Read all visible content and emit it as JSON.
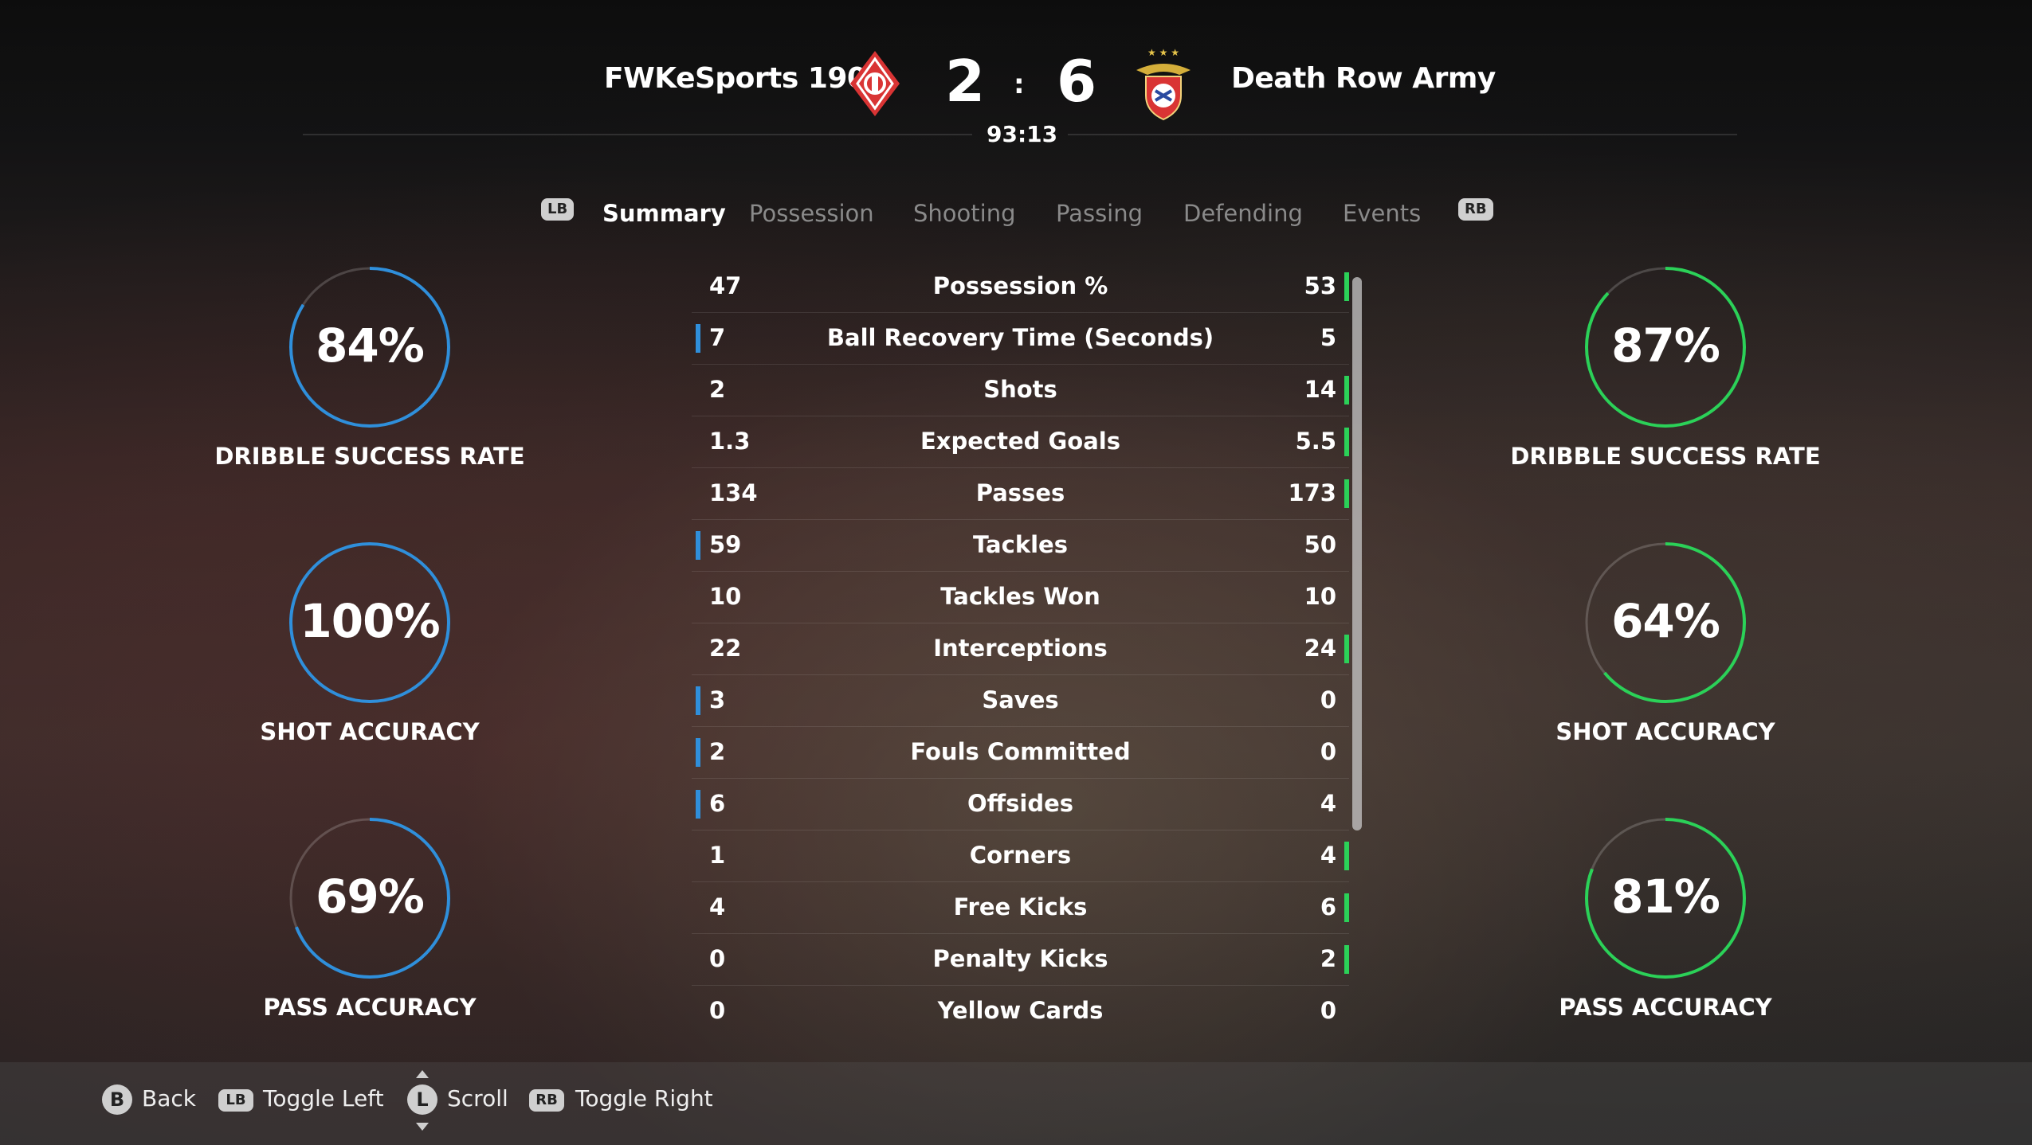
{
  "match": {
    "home_team": "FWKeSports 1907",
    "away_team": "Death Row Army",
    "home_score": "2",
    "away_score": "6",
    "separator": ":",
    "clock": "93:13"
  },
  "tabs": {
    "left_button": "LB",
    "right_button": "RB",
    "items": [
      "Summary",
      "Possession",
      "Shooting",
      "Passing",
      "Defending",
      "Events"
    ],
    "active": "Summary"
  },
  "colors": {
    "home": "#2f8fdb",
    "away": "#2bd158"
  },
  "home_rings": [
    {
      "value": "84%",
      "label": "DRIBBLE SUCCESS RATE",
      "fraction": 0.84
    },
    {
      "value": "100%",
      "label": "SHOT ACCURACY",
      "fraction": 1.0
    },
    {
      "value": "69%",
      "label": "PASS ACCURACY",
      "fraction": 0.69
    }
  ],
  "away_rings": [
    {
      "value": "87%",
      "label": "DRIBBLE SUCCESS RATE",
      "fraction": 0.87
    },
    {
      "value": "64%",
      "label": "SHOT ACCURACY",
      "fraction": 0.64
    },
    {
      "value": "81%",
      "label": "PASS ACCURACY",
      "fraction": 0.81
    }
  ],
  "stats": [
    {
      "name": "Possession %",
      "home": "47",
      "away": "53",
      "leader": "away"
    },
    {
      "name": "Ball Recovery Time (Seconds)",
      "home": "7",
      "away": "5",
      "leader": "home"
    },
    {
      "name": "Shots",
      "home": "2",
      "away": "14",
      "leader": "away"
    },
    {
      "name": "Expected Goals",
      "home": "1.3",
      "away": "5.5",
      "leader": "away"
    },
    {
      "name": "Passes",
      "home": "134",
      "away": "173",
      "leader": "away"
    },
    {
      "name": "Tackles",
      "home": "59",
      "away": "50",
      "leader": "home"
    },
    {
      "name": "Tackles Won",
      "home": "10",
      "away": "10",
      "leader": "none"
    },
    {
      "name": "Interceptions",
      "home": "22",
      "away": "24",
      "leader": "away"
    },
    {
      "name": "Saves",
      "home": "3",
      "away": "0",
      "leader": "home"
    },
    {
      "name": "Fouls Committed",
      "home": "2",
      "away": "0",
      "leader": "home"
    },
    {
      "name": "Offsides",
      "home": "6",
      "away": "4",
      "leader": "home"
    },
    {
      "name": "Corners",
      "home": "1",
      "away": "4",
      "leader": "away"
    },
    {
      "name": "Free Kicks",
      "home": "4",
      "away": "6",
      "leader": "away"
    },
    {
      "name": "Penalty Kicks",
      "home": "0",
      "away": "2",
      "leader": "away"
    },
    {
      "name": "Yellow Cards",
      "home": "0",
      "away": "0",
      "leader": "none"
    }
  ],
  "footer": {
    "back_glyph": "B",
    "back_label": "Back",
    "toggle_left_glyph": "LB",
    "toggle_left_label": "Toggle Left",
    "scroll_glyph": "L",
    "scroll_label": "Scroll",
    "toggle_right_glyph": "RB",
    "toggle_right_label": "Toggle Right"
  }
}
